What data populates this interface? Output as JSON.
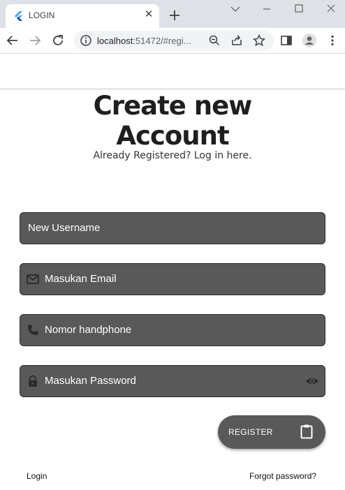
{
  "browser": {
    "tab_title": "LOGIN",
    "url_host": "localhost",
    "url_rest": ":51472/#regi..."
  },
  "page": {
    "headline_line1": "Create new",
    "headline_line2": "Account",
    "subline": "Already Registered? Log in here."
  },
  "form": {
    "username_label": "New Username",
    "email_label": "Masukan Email",
    "phone_label": "Nomor handphone",
    "password_label": "Masukan Password"
  },
  "actions": {
    "register_label": "REGISTER",
    "login_link": "Login",
    "forgot_link": "Forgot password?"
  },
  "icons": {
    "favicon": "flutter-icon",
    "email": "mail-icon",
    "phone": "phone-icon",
    "password": "lock-icon",
    "visibility": "eye-icon",
    "register": "clipboard-icon"
  },
  "colors": {
    "field_bg": "#595959",
    "tabstrip_bg": "#dee1e6",
    "favicon_blue": "#42a5f5"
  }
}
